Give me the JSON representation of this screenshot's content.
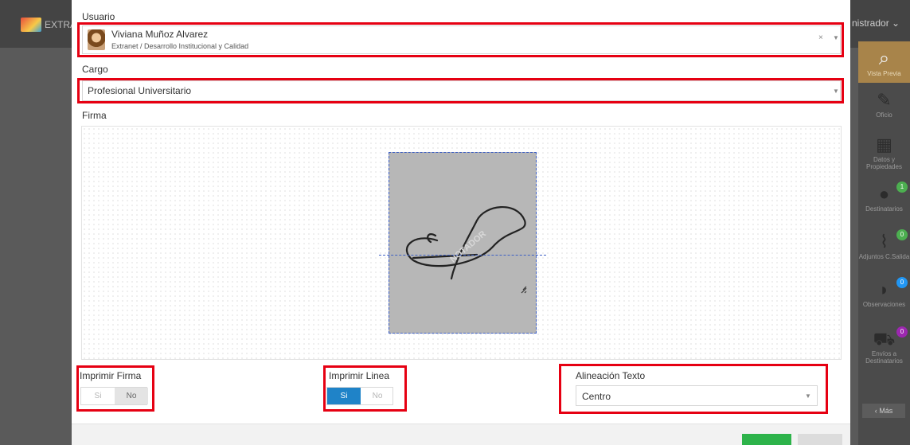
{
  "app": {
    "logo_text": "EXTRA",
    "user_menu": "nistrador ⌄"
  },
  "sidebar": {
    "items": [
      {
        "label": "Vista Previa",
        "icon": "search-icon",
        "glyph": "🔍"
      },
      {
        "label": "Oficio",
        "icon": "edit-icon",
        "glyph": "✎"
      },
      {
        "label": "Datos y Propiedades",
        "icon": "grid-icon",
        "glyph": "▦"
      },
      {
        "label": "Destinatarios",
        "icon": "user-icon",
        "glyph": "👤",
        "badge": "1",
        "badge_color": "#4caf50"
      },
      {
        "label": "Adjuntos C.Salida",
        "icon": "paperclip-icon",
        "glyph": "📎",
        "badge": "0",
        "badge_color": "#4caf50"
      },
      {
        "label": "Observaciones",
        "icon": "comments-icon",
        "glyph": "💬",
        "badge": "0",
        "badge_color": "#2196f3"
      },
      {
        "label": "Envíos a Destinatarios",
        "icon": "truck-icon",
        "glyph": "🚚",
        "badge": "0",
        "badge_color": "#9c27b0"
      }
    ],
    "more_label": "‹ Más"
  },
  "form": {
    "usuario": {
      "label": "Usuario",
      "name": "Viviana Muñoz Alvarez",
      "department": "Extranet / Desarrollo Institucional y Calidad",
      "clear": "×",
      "arrow": "▼"
    },
    "cargo": {
      "label": "Cargo",
      "value": "Profesional Universitario",
      "arrow": "▼"
    },
    "firma": {
      "label": "Firma",
      "watermark": "NOTADOR"
    },
    "imprimir_firma": {
      "label": "Imprimir Firma",
      "on": "Si",
      "off": "No",
      "value": false
    },
    "imprimir_linea": {
      "label": "Imprimir Linea",
      "on": "Si",
      "off": "No",
      "value": true
    },
    "alineacion": {
      "label": "Alineación Texto",
      "value": "Centro",
      "arrow": "▼"
    }
  },
  "colors": {
    "highlight": "#e60012",
    "toggle_on": "#1f83c8",
    "save_button": "#2db34a"
  }
}
